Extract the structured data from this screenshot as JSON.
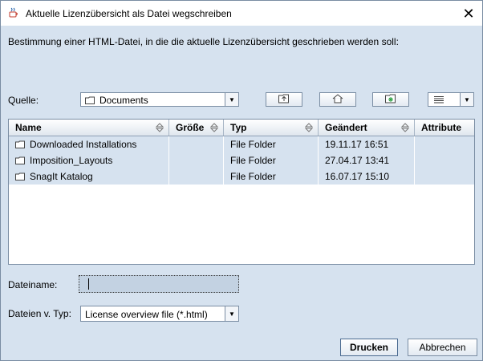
{
  "window": {
    "title": "Aktuelle Lizenzübersicht als Datei wegschreiben",
    "close_glyph": "✕"
  },
  "instruction": "Bestimmung einer HTML-Datei, in die die aktuelle Lizenzübersicht geschrieben werden soll:",
  "source": {
    "label": "Quelle:",
    "value": "Documents"
  },
  "toolbar": {
    "icons": [
      "up-folder-icon",
      "home-icon",
      "new-folder-icon",
      "view-list-icon"
    ]
  },
  "table": {
    "columns": [
      "Name",
      "Größe",
      "Typ",
      "Geändert",
      "Attribute"
    ],
    "rows": [
      {
        "name": "Downloaded Installations",
        "size": "",
        "type": "File Folder",
        "modified": "19.11.17 16:51",
        "attr": ""
      },
      {
        "name": "Imposition_Layouts",
        "size": "",
        "type": "File Folder",
        "modified": "27.04.17 13:41",
        "attr": ""
      },
      {
        "name": "SnagIt Katalog",
        "size": "",
        "type": "File Folder",
        "modified": "16.07.17 15:10",
        "attr": ""
      }
    ]
  },
  "filename": {
    "label": "Dateiname:",
    "value": ""
  },
  "filetype": {
    "label": "Dateien v. Typ:",
    "value": "License overview file (*.html)"
  },
  "buttons": {
    "print": "Drucken",
    "cancel": "Abbrechen"
  },
  "colors": {
    "panel": "#d6e2ef",
    "border": "#7a8da3"
  }
}
